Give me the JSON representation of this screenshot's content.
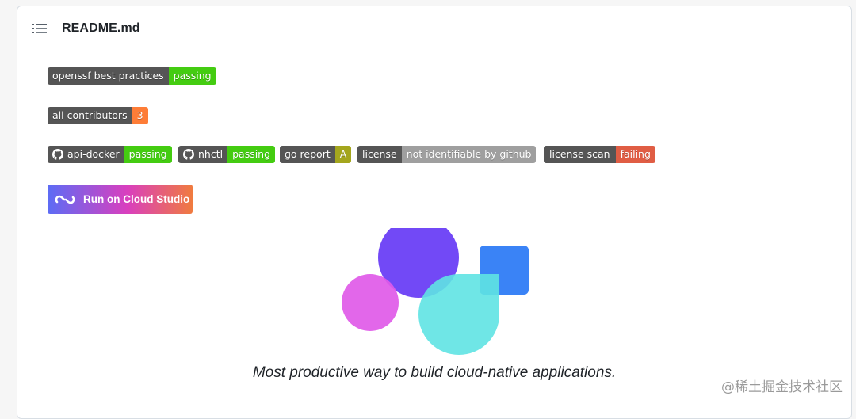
{
  "readme": {
    "title": "README.md"
  },
  "badges": {
    "openssf": {
      "label": "openssf best practices",
      "status": "passing",
      "color": "#4c1"
    },
    "contributors": {
      "label": "all contributors",
      "count": "3",
      "color": "#fe7d37"
    },
    "api_docker": {
      "label": "api-docker",
      "status": "passing",
      "color": "#4c1"
    },
    "nhctl": {
      "label": "nhctl",
      "status": "passing",
      "color": "#4c1"
    },
    "goreport": {
      "label": "go report",
      "grade": "A",
      "color": "#a4a61d"
    },
    "license": {
      "label": "license",
      "status": "not identifiable by github",
      "color": "#9f9f9f"
    },
    "license_scan": {
      "label": "license scan",
      "status": "failing",
      "color": "#e05d44"
    }
  },
  "cloud_studio": {
    "label": "Run on Cloud Studio",
    "gradient": [
      "#5c6cf5",
      "#d93fbe",
      "#f07b3f"
    ]
  },
  "hero": {
    "tagline": "Most productive way to build cloud-native applications.",
    "colors": {
      "purple": "#6a3ff6",
      "pink": "#e05ae8",
      "cyan": "#5fe3e3",
      "blue": "#2f7cf6"
    }
  },
  "watermark": {
    "text": "@稀土掘金技术社区"
  }
}
